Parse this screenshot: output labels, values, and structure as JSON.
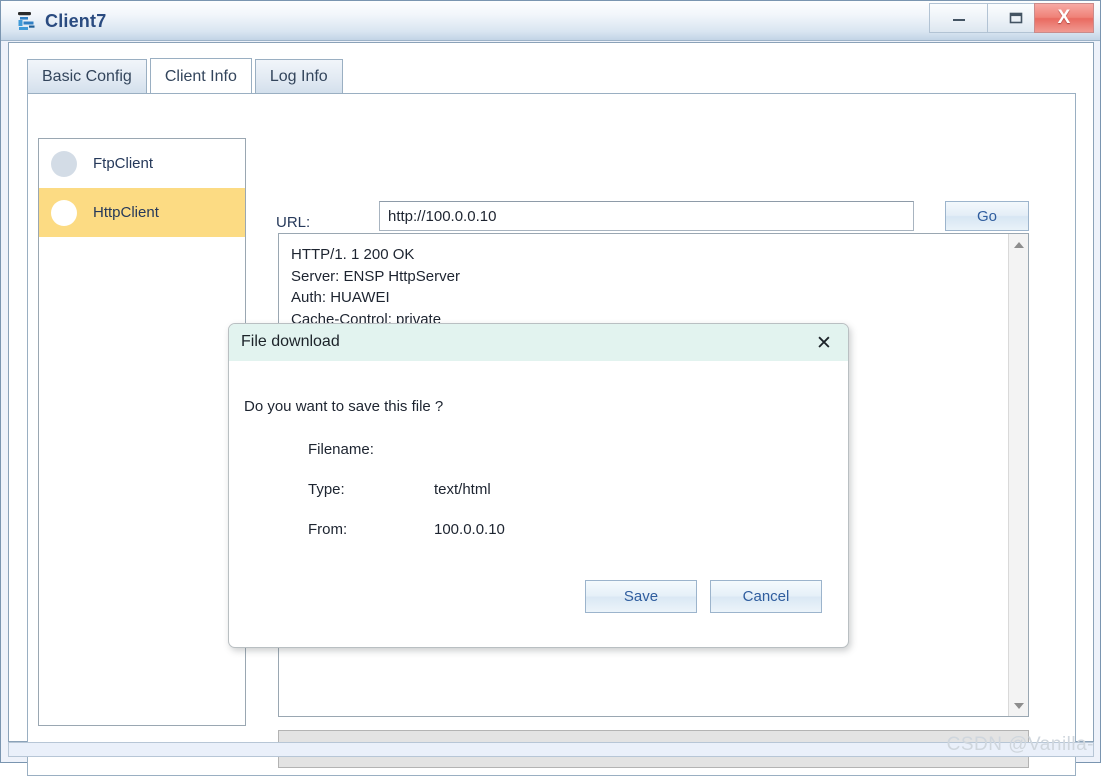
{
  "window": {
    "title": "Client7",
    "icon": "client-device-icon",
    "controls": {
      "minimize": "—",
      "maximize": "❐",
      "close": "X"
    }
  },
  "tabs": [
    {
      "label": "Basic Config",
      "active": false
    },
    {
      "label": "Client Info",
      "active": true
    },
    {
      "label": "Log Info",
      "active": false
    }
  ],
  "sidebar": {
    "items": [
      {
        "label": "FtpClient",
        "icon": "grey-circle-icon",
        "selected": false
      },
      {
        "label": "HttpClient",
        "icon": "white-circle-icon",
        "selected": true
      }
    ]
  },
  "main": {
    "url_label": "URL:",
    "url_value": "http://100.0.0.10",
    "url_placeholder": "http://",
    "go_label": "Go",
    "response_text": "HTTP/1. 1 200 OK\nServer: ENSP HttpServer\nAuth: HUAWEI\nCache-Control: private\nContent-Type: text/html\nContent-Length: 179",
    "bottom_field_value": ""
  },
  "dialog": {
    "title": "File download",
    "close_icon": "✕",
    "question": "Do you want to save this file ?",
    "rows": [
      {
        "label": "Filename:",
        "value": ""
      },
      {
        "label": "Type:",
        "value": "text/html"
      },
      {
        "label": "From:",
        "value": "100.0.0.10"
      }
    ],
    "save_label": "Save",
    "cancel_label": "Cancel"
  },
  "watermark": "CSDN @Vanilla-",
  "colors": {
    "selected_row": "#fcdb83",
    "dialog_header": "#e2f3ef",
    "close_button": "#ef8177",
    "link_blue": "#2f5d9e",
    "title_text": "#2a4b80"
  }
}
